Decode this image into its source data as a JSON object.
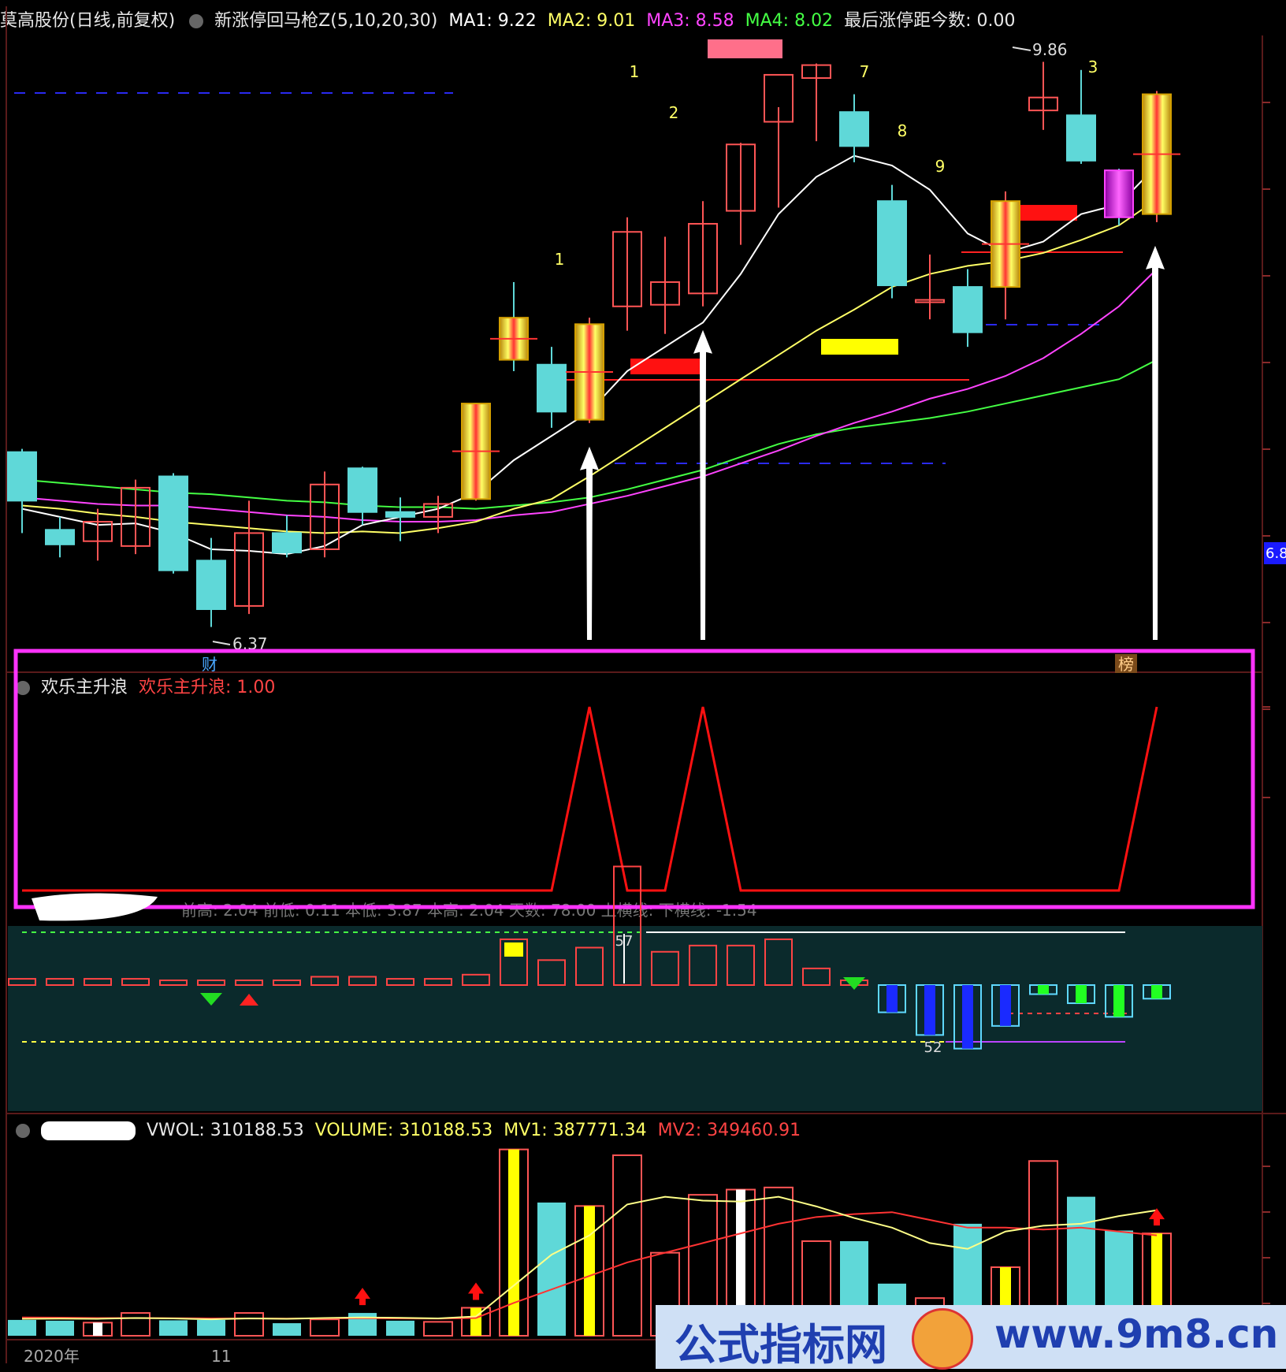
{
  "header": {
    "title": "莫高股份(日线,前复权)",
    "indicator": "新涨停回马枪Z(5,10,20,30)",
    "ma1": "MA1: 9.22",
    "ma2": "MA2: 9.01",
    "ma3": "MA3: 8.58",
    "ma4": "MA4: 8.02",
    "last_limit": "最后涨停距今数: 0.00"
  },
  "panel2": {
    "name": "欢乐主升浪",
    "value": "欢乐主升浪: 1.00"
  },
  "panel3": {
    "legend": "前高: 2.04 前低: 0.11 本低: 3.87 本高: 2.04 天数: 78.00 上横线: 下横线: -1.54"
  },
  "panel4": {
    "vwol": "VWOL: 310188.53",
    "volume": "VOLUME: 310188.53",
    "mv1": "MV1: 387771.34",
    "mv2": "MV2: 349460.91"
  },
  "colors": {
    "up": "#ff5555",
    "down": "#5fd8d8",
    "ma1": "#ffffff",
    "ma2": "#ffff66",
    "ma3": "#ff44ff",
    "ma4": "#44ff44",
    "highlight_box": "#ff33ff",
    "signal": "#ff1111"
  },
  "chart_data": [
    {
      "type": "candlestick",
      "labels": {
        "high": "9.86",
        "low": "6.37",
        "right_axis": "6.8",
        "marker_left": "财",
        "marker_right": "榜"
      },
      "wave_numbers": [
        "1",
        "2",
        "1",
        "7",
        "8",
        "9",
        "3"
      ],
      "candles": [
        {
          "o": 7.45,
          "h": 7.47,
          "l": 6.95,
          "c": 7.15
        },
        {
          "o": 6.97,
          "h": 7.05,
          "l": 6.8,
          "c": 6.88
        },
        {
          "o": 6.9,
          "h": 7.1,
          "l": 6.78,
          "c": 7.02
        },
        {
          "o": 6.87,
          "h": 7.28,
          "l": 6.82,
          "c": 7.23
        },
        {
          "o": 7.3,
          "h": 7.32,
          "l": 6.7,
          "c": 6.72
        },
        {
          "o": 6.78,
          "h": 6.92,
          "l": 6.37,
          "c": 6.48
        },
        {
          "o": 6.5,
          "h": 7.15,
          "l": 6.45,
          "c": 6.95
        },
        {
          "o": 6.95,
          "h": 7.06,
          "l": 6.8,
          "c": 6.83
        },
        {
          "o": 6.85,
          "h": 7.33,
          "l": 6.8,
          "c": 7.25
        },
        {
          "o": 7.35,
          "h": 7.36,
          "l": 7.0,
          "c": 7.08
        },
        {
          "o": 7.08,
          "h": 7.17,
          "l": 6.9,
          "c": 7.05
        },
        {
          "o": 7.05,
          "h": 7.18,
          "l": 6.95,
          "c": 7.13
        },
        {
          "o": 7.16,
          "h": 7.75,
          "l": 7.15,
          "c": 7.75
        },
        {
          "o": 8.28,
          "h": 8.5,
          "l": 7.95,
          "c": 8.02
        },
        {
          "o": 7.99,
          "h": 8.1,
          "l": 7.6,
          "c": 7.7
        },
        {
          "o": 7.65,
          "h": 8.28,
          "l": 7.63,
          "c": 8.24
        },
        {
          "o": 8.35,
          "h": 8.9,
          "l": 8.2,
          "c": 8.81
        },
        {
          "o": 8.36,
          "h": 8.78,
          "l": 8.18,
          "c": 8.5
        },
        {
          "o": 8.43,
          "h": 9.0,
          "l": 8.35,
          "c": 8.86
        },
        {
          "o": 8.94,
          "h": 9.36,
          "l": 8.73,
          "c": 9.35
        },
        {
          "o": 9.49,
          "h": 9.58,
          "l": 8.96,
          "c": 9.78
        },
        {
          "o": 9.76,
          "h": 9.85,
          "l": 9.37,
          "c": 9.84
        },
        {
          "o": 9.55,
          "h": 9.66,
          "l": 9.24,
          "c": 9.34
        },
        {
          "o": 9.0,
          "h": 9.1,
          "l": 8.4,
          "c": 8.48
        },
        {
          "o": 8.39,
          "h": 8.67,
          "l": 8.27,
          "c": 8.39
        },
        {
          "o": 8.47,
          "h": 8.58,
          "l": 8.1,
          "c": 8.19
        },
        {
          "o": 8.47,
          "h": 9.06,
          "l": 8.27,
          "c": 9.0
        },
        {
          "o": 9.56,
          "h": 9.86,
          "l": 9.44,
          "c": 9.64
        },
        {
          "o": 9.53,
          "h": 9.81,
          "l": 9.23,
          "c": 9.25
        },
        {
          "o": 9.19,
          "h": 9.2,
          "l": 8.85,
          "c": 8.9
        },
        {
          "o": 8.92,
          "h": 9.68,
          "l": 8.87,
          "c": 9.66
        }
      ],
      "ma1": [
        7.1,
        7.05,
        7.0,
        7.01,
        6.95,
        6.85,
        6.84,
        6.82,
        6.87,
        7.0,
        7.05,
        7.1,
        7.2,
        7.4,
        7.55,
        7.7,
        7.95,
        8.1,
        8.25,
        8.55,
        8.92,
        9.15,
        9.28,
        9.22,
        9.07,
        8.8,
        8.68,
        8.75,
        8.92,
        8.98,
        9.22
      ],
      "ma2": [
        7.12,
        7.1,
        7.07,
        7.05,
        7.02,
        7.0,
        6.98,
        6.96,
        6.95,
        6.96,
        6.95,
        6.98,
        7.02,
        7.1,
        7.16,
        7.3,
        7.45,
        7.6,
        7.75,
        7.9,
        8.05,
        8.2,
        8.33,
        8.47,
        8.55,
        8.6,
        8.63,
        8.68,
        8.76,
        8.85,
        9.01
      ],
      "ma3": [
        7.17,
        7.15,
        7.13,
        7.12,
        7.12,
        7.1,
        7.08,
        7.06,
        7.05,
        7.03,
        7.02,
        7.02,
        7.03,
        7.06,
        7.08,
        7.13,
        7.18,
        7.24,
        7.3,
        7.38,
        7.46,
        7.55,
        7.63,
        7.7,
        7.78,
        7.84,
        7.92,
        8.03,
        8.18,
        8.35,
        8.58
      ],
      "ma4": [
        7.28,
        7.26,
        7.24,
        7.22,
        7.2,
        7.19,
        7.17,
        7.15,
        7.14,
        7.12,
        7.11,
        7.11,
        7.1,
        7.12,
        7.14,
        7.17,
        7.22,
        7.28,
        7.34,
        7.42,
        7.5,
        7.56,
        7.6,
        7.63,
        7.66,
        7.7,
        7.75,
        7.8,
        7.85,
        7.9,
        8.02
      ]
    },
    {
      "type": "line",
      "series": [
        {
          "name": "欢乐主升浪",
          "values": [
            0,
            0,
            0,
            0,
            0,
            0,
            0,
            0,
            0,
            0,
            0,
            0,
            0,
            0,
            0,
            1,
            0,
            0,
            1,
            0,
            0,
            0,
            0,
            0,
            0,
            0,
            0,
            0,
            0,
            0,
            1
          ]
        }
      ]
    },
    {
      "type": "bar",
      "labels": {
        "top": "57",
        "bottom": "52"
      },
      "values": [
        3,
        3,
        3,
        3,
        0,
        1,
        2,
        2,
        4,
        4,
        3,
        3,
        5,
        22,
        12,
        18,
        57,
        16,
        19,
        19,
        22,
        8,
        0,
        -12,
        -22,
        -28,
        -18,
        -4,
        -8,
        -14,
        -6
      ]
    },
    {
      "type": "bar",
      "axis_labels": [
        "2020年",
        "11"
      ],
      "volume": [
        82000,
        78000,
        68000,
        118000,
        80000,
        82000,
        118000,
        65000,
        85000,
        118000,
        78000,
        72000,
        145000,
        965000,
        690000,
        672000,
        935000,
        430000,
        730000,
        757000,
        768000,
        490000,
        490000,
        270000,
        195000,
        580000,
        355000,
        905000,
        720000,
        545000,
        530000
      ],
      "mv1": [
        88000,
        89000,
        88000,
        92000,
        90000,
        85000,
        90000,
        88000,
        92000,
        95000,
        93000,
        90000,
        100000,
        260000,
        420000,
        520000,
        680000,
        720000,
        700000,
        695000,
        720000,
        670000,
        610000,
        560000,
        480000,
        450000,
        540000,
        570000,
        580000,
        620000,
        650000
      ],
      "mv2": [
        95000,
        94000,
        92000,
        92000,
        91000,
        90000,
        90000,
        89000,
        90000,
        91000,
        90000,
        89000,
        92000,
        170000,
        240000,
        310000,
        380000,
        430000,
        480000,
        530000,
        580000,
        615000,
        630000,
        640000,
        600000,
        560000,
        560000,
        550000,
        560000,
        540000,
        520000
      ]
    }
  ]
}
